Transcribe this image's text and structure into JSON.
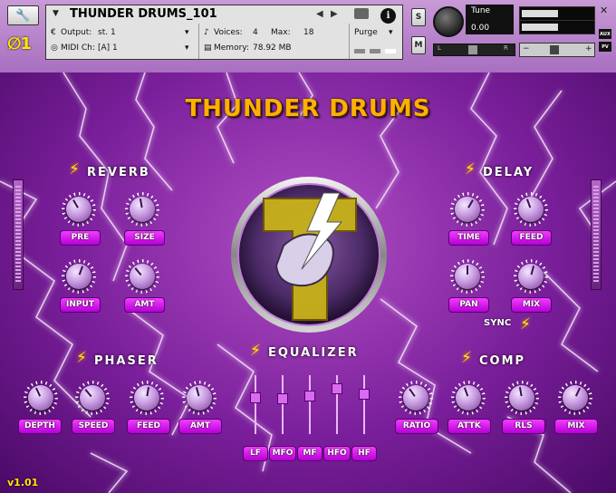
{
  "header": {
    "instrument_name": "THUNDER DRUMS_101",
    "output_label": "Output:",
    "output_value": "st. 1",
    "midi_label": "MIDI Ch:",
    "midi_value": "[A]  1",
    "voices_label": "Voices:",
    "voices_value": "4",
    "max_label": "Max:",
    "max_value": "18",
    "memory_label": "Memory:",
    "memory_value": "78.92 MB",
    "purge_label": "Purge",
    "info_label": "i",
    "solo_label": "S",
    "mute_label": "M",
    "tune_label": "Tune",
    "tune_value": "0.00",
    "pan_left": "L",
    "pan_right": "R",
    "vol_minus": "−",
    "vol_plus": "+",
    "aux_label": "AUX",
    "pv_label": "PV",
    "brand": "∅1"
  },
  "title": "THUNDER DRUMS",
  "sections": {
    "reverb": {
      "title": "REVERB",
      "knobs": [
        "PRE",
        "SIZE",
        "INPUT",
        "AMT"
      ]
    },
    "delay": {
      "title": "DELAY",
      "knobs": [
        "TIME",
        "FEED",
        "PAN",
        "MIX"
      ],
      "sync_label": "SYNC"
    },
    "phaser": {
      "title": "PHASER",
      "knobs": [
        "DEPTH",
        "SPEED",
        "FEED",
        "AMT"
      ]
    },
    "equalizer": {
      "title": "EQUALIZER",
      "bands": [
        "LF",
        "MFO",
        "MF",
        "HFO",
        "HF"
      ]
    },
    "comp": {
      "title": "COMP",
      "knobs": [
        "RATIO",
        "ATTK",
        "RLS",
        "MIX"
      ]
    }
  },
  "version": "v1.01",
  "colors": {
    "accent": "#ffb000",
    "label_pill": "#d81ef0",
    "bolt": "#ffe600",
    "background": "#7a1f9b"
  }
}
